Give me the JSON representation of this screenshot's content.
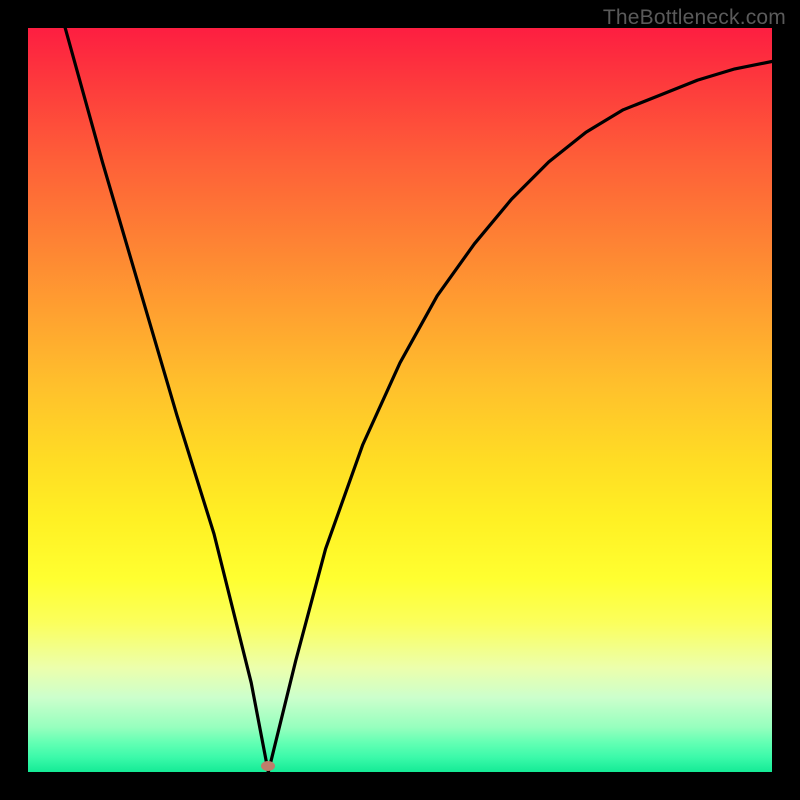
{
  "watermark": "TheBottleneck.com",
  "chart_data": {
    "type": "line",
    "title": "",
    "xlabel": "",
    "ylabel": "",
    "xlim": [
      0,
      1
    ],
    "ylim": [
      0,
      1
    ],
    "curve": {
      "x": [
        0.05,
        0.1,
        0.15,
        0.2,
        0.25,
        0.3,
        0.323,
        0.36,
        0.4,
        0.45,
        0.5,
        0.55,
        0.6,
        0.65,
        0.7,
        0.75,
        0.8,
        0.85,
        0.9,
        0.95,
        1.0
      ],
      "y": [
        1.0,
        0.82,
        0.65,
        0.48,
        0.32,
        0.12,
        0.0,
        0.15,
        0.3,
        0.44,
        0.55,
        0.64,
        0.71,
        0.77,
        0.82,
        0.86,
        0.89,
        0.91,
        0.93,
        0.945,
        0.955
      ]
    },
    "marker": {
      "x": 0.323,
      "y": 0.005,
      "color": "#bf7d6b"
    },
    "gradient_stops": [
      {
        "pos": 0.0,
        "color": "rgb(253,30,65)"
      },
      {
        "pos": 0.5,
        "color": "rgb(255,200,40)"
      },
      {
        "pos": 0.78,
        "color": "rgb(255,255,80)"
      },
      {
        "pos": 1.0,
        "color": "rgb(20,235,150)"
      }
    ]
  }
}
